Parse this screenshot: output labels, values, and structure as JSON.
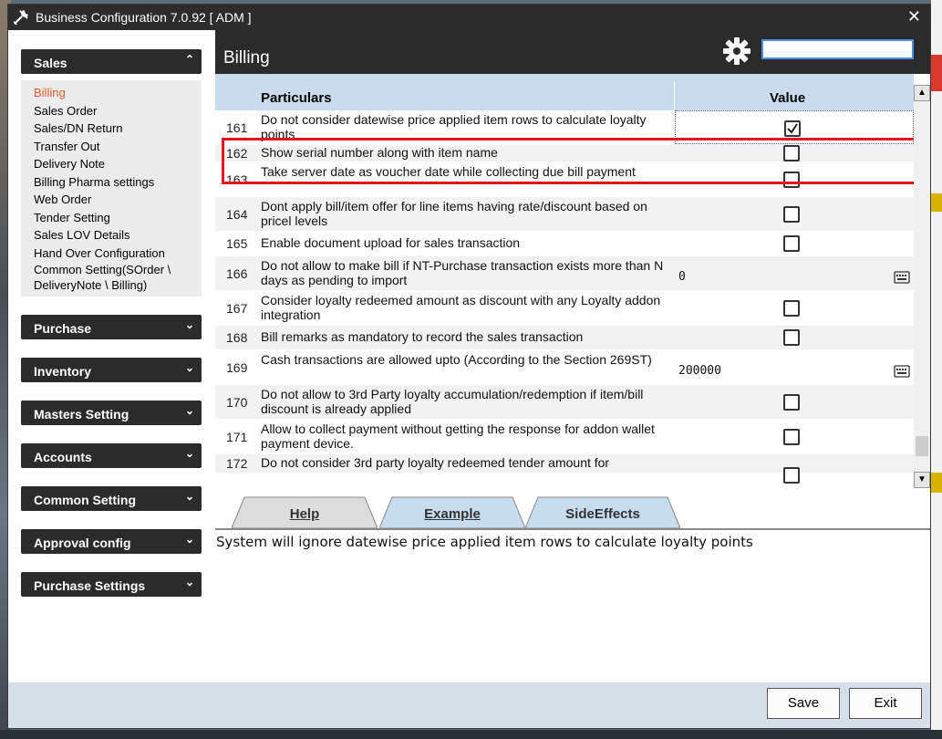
{
  "window": {
    "title": "Business Configuration 7.0.92 [ ADM ]",
    "close_glyph": "✕"
  },
  "sidebar": {
    "sections": [
      {
        "label": "Sales",
        "chevron": "⌃"
      },
      {
        "label": "Purchase",
        "chevron": "⌄"
      },
      {
        "label": "Inventory",
        "chevron": "⌄"
      },
      {
        "label": "Masters Setting",
        "chevron": "⌄"
      },
      {
        "label": "Accounts",
        "chevron": "⌄"
      },
      {
        "label": "Common Setting",
        "chevron": "⌄"
      },
      {
        "label": "Approval config",
        "chevron": "⌄"
      },
      {
        "label": "Purchase Settings",
        "chevron": "⌄"
      }
    ],
    "sales_items": [
      "Billing",
      "Sales Order",
      "Sales/DN Return",
      "Transfer Out",
      "Delivery Note",
      "Billing Pharma settings",
      "Web Order",
      "Tender Setting",
      "Sales LOV Details",
      "Hand Over Configuration",
      "Common Setting(SOrder \\",
      "DeliveryNote \\ Billing)"
    ],
    "active_item": "Billing"
  },
  "header": {
    "title": "Billing",
    "search_value": ""
  },
  "grid": {
    "col_particulars": "Particulars",
    "col_value": "Value",
    "rows": [
      {
        "num": "161",
        "text": "Do not consider datewise price applied item rows to calculate loyalty points",
        "type": "check",
        "checked": true
      },
      {
        "num": "162",
        "text": "Show serial number along with item name",
        "type": "check",
        "checked": false
      },
      {
        "num": "163",
        "text": "Take server date as voucher date while collecting due bill payment",
        "type": "check",
        "checked": false
      },
      {
        "num": "164",
        "text": "Dont apply bill/item offer for line items having rate/discount based on pricel levels",
        "type": "check",
        "checked": false
      },
      {
        "num": "165",
        "text": "Enable document upload for sales transaction",
        "type": "check",
        "checked": false
      },
      {
        "num": "166",
        "text": "Do not allow to make bill if NT-Purchase transaction exists more than N days as pending to import",
        "type": "text",
        "value": "0"
      },
      {
        "num": "167",
        "text": "Consider loyalty redeemed amount as discount with any Loyalty addon integration",
        "type": "check",
        "checked": false
      },
      {
        "num": "168",
        "text": "Bill remarks as mandatory to record the sales transaction",
        "type": "check",
        "checked": false
      },
      {
        "num": "169",
        "text": "Cash transactions are allowed upto (According to the Section 269ST)",
        "type": "text",
        "value": "200000"
      },
      {
        "num": "170",
        "text": "Do not allow to 3rd Party loyalty accumulation/redemption if item/bill discount is already applied",
        "type": "check",
        "checked": false
      },
      {
        "num": "171",
        "text": "Allow to collect payment without getting the response for addon wallet payment device.",
        "type": "check",
        "checked": false
      },
      {
        "num": "172",
        "text": "Do not consider 3rd party loyalty redeemed tender amount for",
        "type": "check",
        "checked": false
      }
    ]
  },
  "tabs": [
    {
      "label": "Help",
      "active": true
    },
    {
      "label": "Example",
      "active": false
    },
    {
      "label": "SideEffects",
      "active": false
    }
  ],
  "description": "System will ignore datewise price applied item rows to calculate loyalty points",
  "buttons": {
    "save": "Save",
    "exit": "Exit"
  },
  "colors": {
    "accent_orange": "#e05a2a",
    "highlight_red": "#e8141e",
    "header_dark": "#2b2b2b",
    "grid_head_blue": "#c8dcee"
  }
}
